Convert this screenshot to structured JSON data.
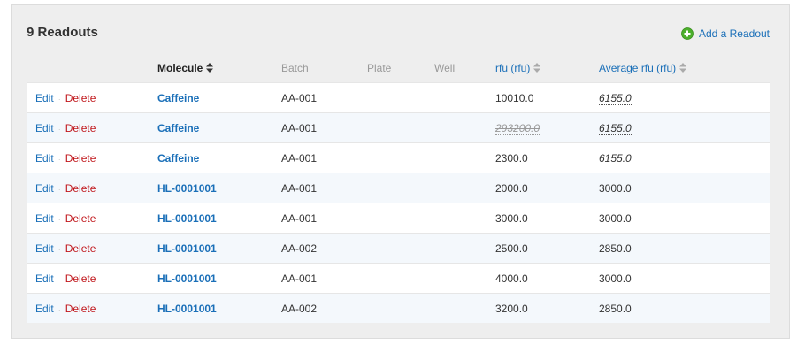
{
  "panel": {
    "title": "9 Readouts",
    "add_label": "Add a Readout",
    "add_icon": "plus-circle-icon",
    "add_icon_color": "#4caf2c"
  },
  "table": {
    "columns": {
      "molecule": "Molecule",
      "batch": "Batch",
      "plate": "Plate",
      "well": "Well",
      "rfu": "rfu (rfu)",
      "avg": "Average rfu (rfu)"
    },
    "actions": {
      "edit": "Edit",
      "sep": "·",
      "delete": "Delete"
    },
    "rows": [
      {
        "molecule": "Caffeine",
        "batch": "AA-001",
        "rfu": "10010.0",
        "avg": "6155.0"
      },
      {
        "molecule": "Caffeine",
        "batch": "AA-001",
        "rfu": "293200.0",
        "avg": "6155.0"
      },
      {
        "molecule": "Caffeine",
        "batch": "AA-001",
        "rfu": "2300.0",
        "avg": "6155.0"
      },
      {
        "molecule": "HL-0001001",
        "batch": "AA-001",
        "rfu": "2000.0",
        "avg": "3000.0"
      },
      {
        "molecule": "HL-0001001",
        "batch": "AA-001",
        "rfu": "3000.0",
        "avg": "3000.0"
      },
      {
        "molecule": "HL-0001001",
        "batch": "AA-002",
        "rfu": "2500.0",
        "avg": "2850.0"
      },
      {
        "molecule": "HL-0001001",
        "batch": "AA-001",
        "rfu": "4000.0",
        "avg": "3000.0"
      },
      {
        "molecule": "HL-0001001",
        "batch": "AA-002",
        "rfu": "3200.0",
        "avg": "2850.0"
      }
    ]
  }
}
